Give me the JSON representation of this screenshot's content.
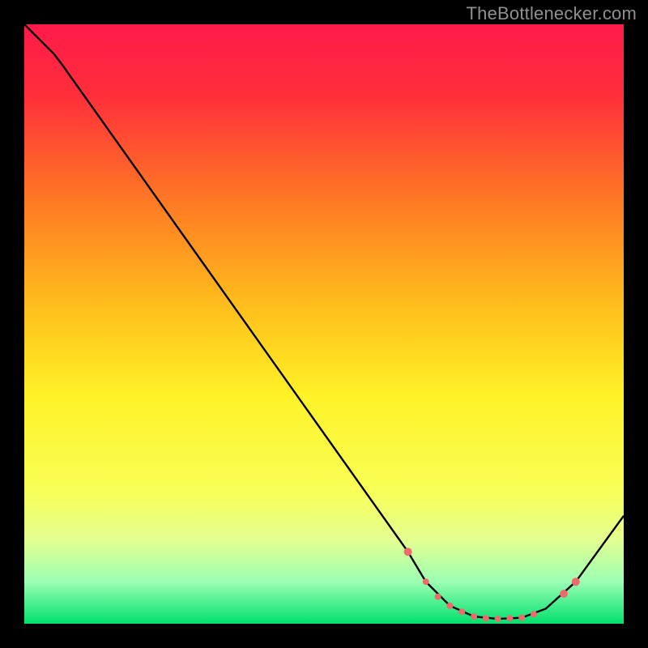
{
  "attribution": "TheBottlenecker.com",
  "chart_data": {
    "type": "line",
    "title": "",
    "xlabel": "",
    "ylabel": "",
    "xlim": [
      0,
      100
    ],
    "ylim": [
      0,
      100
    ],
    "background_gradient": {
      "stops": [
        {
          "offset": 0.0,
          "color": "#ff1a4b"
        },
        {
          "offset": 0.12,
          "color": "#ff2f3a"
        },
        {
          "offset": 0.3,
          "color": "#ff7b24"
        },
        {
          "offset": 0.48,
          "color": "#ffc21c"
        },
        {
          "offset": 0.62,
          "color": "#fff227"
        },
        {
          "offset": 0.78,
          "color": "#f8ff58"
        },
        {
          "offset": 0.86,
          "color": "#e4ff91"
        },
        {
          "offset": 0.93,
          "color": "#9bffb3"
        },
        {
          "offset": 1.0,
          "color": "#00e06d"
        }
      ]
    },
    "curve_xy": [
      {
        "x": 0,
        "y": 100
      },
      {
        "x": 5,
        "y": 95
      },
      {
        "x": 6.5,
        "y": 93
      },
      {
        "x": 64,
        "y": 12
      },
      {
        "x": 67,
        "y": 7
      },
      {
        "x": 71,
        "y": 3
      },
      {
        "x": 75,
        "y": 1.2
      },
      {
        "x": 79,
        "y": 0.8
      },
      {
        "x": 83,
        "y": 1.0
      },
      {
        "x": 87,
        "y": 2.5
      },
      {
        "x": 92,
        "y": 7
      },
      {
        "x": 100,
        "y": 18
      }
    ],
    "markers": [
      {
        "x": 64,
        "y": 12,
        "r": 5
      },
      {
        "x": 67,
        "y": 7,
        "r": 4
      },
      {
        "x": 69,
        "y": 4.5,
        "r": 4
      },
      {
        "x": 71,
        "y": 3,
        "r": 4
      },
      {
        "x": 73,
        "y": 2,
        "r": 4
      },
      {
        "x": 75,
        "y": 1.2,
        "r": 4
      },
      {
        "x": 77,
        "y": 0.9,
        "r": 4
      },
      {
        "x": 79,
        "y": 0.8,
        "r": 4
      },
      {
        "x": 81,
        "y": 0.9,
        "r": 4
      },
      {
        "x": 83,
        "y": 1.0,
        "r": 4
      },
      {
        "x": 85,
        "y": 1.6,
        "r": 4
      },
      {
        "x": 90,
        "y": 5,
        "r": 5
      },
      {
        "x": 92,
        "y": 7,
        "r": 5
      }
    ],
    "marker_color": "#ef6b6b",
    "curve_color": "#000000"
  }
}
